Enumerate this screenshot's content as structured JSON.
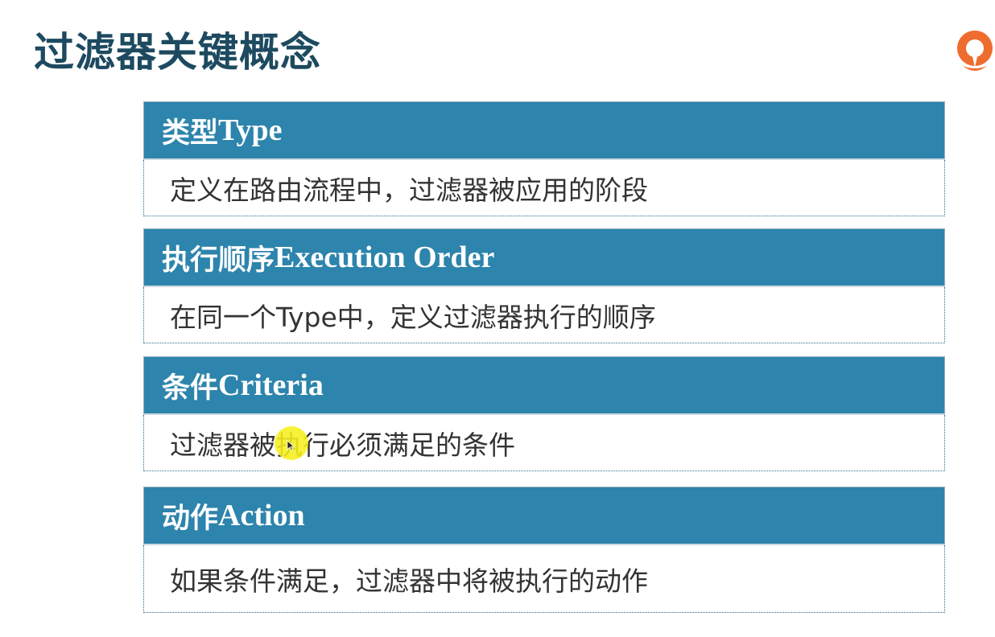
{
  "slide": {
    "title": "过滤器关键概念",
    "logo_icon": "orange-round-logo"
  },
  "colors": {
    "title": "#1d4a60",
    "header_bg": "#2d84ac",
    "logo": "#ef6c2f"
  },
  "sections": [
    {
      "title_zh": "类型",
      "title_en": "Type",
      "description": "定义在路由流程中，过滤器被应用的阶段"
    },
    {
      "title_zh": "执行顺序",
      "title_en": "Execution Order",
      "description": "在同一个Type中，定义过滤器执行的顺序"
    },
    {
      "title_zh": "条件",
      "title_en": "Criteria",
      "description": "过滤器被执行必须满足的条件"
    },
    {
      "title_zh": "动作",
      "title_en": "Action",
      "description": "如果条件满足，过滤器中将被执行的动作"
    }
  ]
}
